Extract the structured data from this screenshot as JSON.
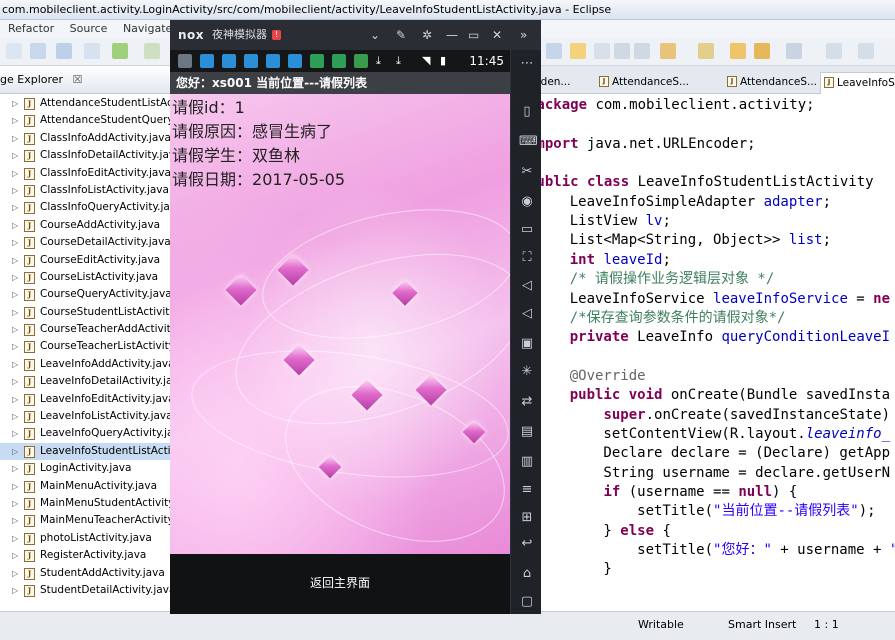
{
  "eclipse": {
    "title": "com.mobileclient.activity.LoginActivity/src/com/mobileclient/activity/LeaveInfoStudentListActivity.java - Eclipse",
    "menu": [
      "Refactor",
      "Source",
      "Navigate"
    ],
    "explorer_tab": "ge Explorer",
    "explorer_close": "☒",
    "files": [
      "AttendanceStudentListActivity.java",
      "AttendanceStudentQueryActivity.java",
      "ClassInfoAddActivity.java",
      "ClassInfoDetailActivity.java",
      "ClassInfoEditActivity.java",
      "ClassInfoListActivity.java",
      "ClassInfoQueryActivity.java",
      "CourseAddActivity.java",
      "CourseDetailActivity.java",
      "CourseEditActivity.java",
      "CourseListActivity.java",
      "CourseQueryActivity.java",
      "CourseStudentListActivity.java",
      "CourseTeacherAddActivity.java",
      "CourseTeacherListActivity.java",
      "LeaveInfoAddActivity.java",
      "LeaveInfoDetailActivity.java",
      "LeaveInfoEditActivity.java",
      "LeaveInfoListActivity.java",
      "LeaveInfoQueryActivity.java",
      "LeaveInfoStudentListActivity.java",
      "LoginActivity.java",
      "MainMenuActivity.java",
      "MainMenuStudentActivity.java",
      "MainMenuTeacherActivity.java",
      "photoListActivity.java",
      "RegisterActivity.java",
      "StudentAddActivity.java",
      "StudentDetailActivity.java"
    ],
    "selected_file_index": 20,
    "editor_tabs": [
      "uden...",
      "AttendanceS...",
      "AttendanceS...",
      "LeaveInfoSt..."
    ],
    "code": [
      [
        {
          "t": "package",
          "c": "kw"
        },
        {
          "t": " com.mobileclient.activity;"
        }
      ],
      [],
      [
        {
          "t": "import",
          "c": "kw"
        },
        {
          "t": " java.net.URLEncoder;"
        }
      ],
      [],
      [
        {
          "t": "public class",
          "c": "kw"
        },
        {
          "t": " LeaveInfoStudentListActivity "
        }
      ],
      [
        {
          "t": "    LeaveInfoSimpleAdapter "
        },
        {
          "t": "adapter",
          "c": "fld"
        },
        {
          "t": ";"
        }
      ],
      [
        {
          "t": "    ListView "
        },
        {
          "t": "lv",
          "c": "fld"
        },
        {
          "t": ";"
        }
      ],
      [
        {
          "t": "    List<Map<String, Object>> "
        },
        {
          "t": "list",
          "c": "fld"
        },
        {
          "t": ";"
        }
      ],
      [
        {
          "t": "    "
        },
        {
          "t": "int",
          "c": "kw"
        },
        {
          "t": " "
        },
        {
          "t": "leaveId",
          "c": "fld"
        },
        {
          "t": ";"
        }
      ],
      [
        {
          "t": "    /* 请假操作业务逻辑层对象 */",
          "c": "cm"
        }
      ],
      [
        {
          "t": "    LeaveInfoService "
        },
        {
          "t": "leaveInfoService",
          "c": "fld"
        },
        {
          "t": " = "
        },
        {
          "t": "ne",
          "c": "kw"
        }
      ],
      [
        {
          "t": "    /*保存查询参数条件的请假对象*/",
          "c": "cm"
        }
      ],
      [
        {
          "t": "    "
        },
        {
          "t": "private",
          "c": "kw"
        },
        {
          "t": " LeaveInfo "
        },
        {
          "t": "queryConditionLeaveI",
          "c": "fld"
        }
      ],
      [],
      [
        {
          "t": "    @Override",
          "c": "ann"
        }
      ],
      [
        {
          "t": "    "
        },
        {
          "t": "public void",
          "c": "kw"
        },
        {
          "t": " onCreate(Bundle savedInsta"
        }
      ],
      [
        {
          "t": "        "
        },
        {
          "t": "super",
          "c": "kw"
        },
        {
          "t": ".onCreate(savedInstanceState)"
        }
      ],
      [
        {
          "t": "        setContentView(R.layout."
        },
        {
          "t": "leaveinfo_",
          "c": "fld it"
        }
      ],
      [
        {
          "t": "        Declare declare = (Declare) getApp"
        }
      ],
      [
        {
          "t": "        String username = declare.getUserN"
        }
      ],
      [
        {
          "t": "        "
        },
        {
          "t": "if",
          "c": "kw"
        },
        {
          "t": " (username == "
        },
        {
          "t": "null",
          "c": "kw"
        },
        {
          "t": ") {"
        }
      ],
      [
        {
          "t": "            setTitle("
        },
        {
          "t": "\"当前位置--请假列表\"",
          "c": "str"
        },
        {
          "t": ");"
        }
      ],
      [
        {
          "t": "        } "
        },
        {
          "t": "else",
          "c": "kw"
        },
        {
          "t": " {"
        }
      ],
      [
        {
          "t": "            setTitle("
        },
        {
          "t": "\"您好：\"",
          "c": "str"
        },
        {
          "t": " + username + "
        },
        {
          "t": "\"",
          "c": "str"
        }
      ],
      [
        {
          "t": "        }"
        }
      ]
    ],
    "status": {
      "mode": "Writable",
      "insert": "Smart Insert",
      "pos": "1 : 1"
    }
  },
  "emulator": {
    "logo": "nox",
    "name": "夜神模拟器",
    "badge": "!",
    "time": "11:45",
    "action_title": "您好：xs001   当前位置---请假列表",
    "fields": [
      {
        "label": "请假id：",
        "value": "1"
      },
      {
        "label": "请假原因：",
        "value": "感冒生病了"
      },
      {
        "label": "请假学生：",
        "value": "双鱼林"
      },
      {
        "label": "请假日期：",
        "value": "2017-05-05"
      }
    ],
    "back_button": "返回主界面"
  }
}
